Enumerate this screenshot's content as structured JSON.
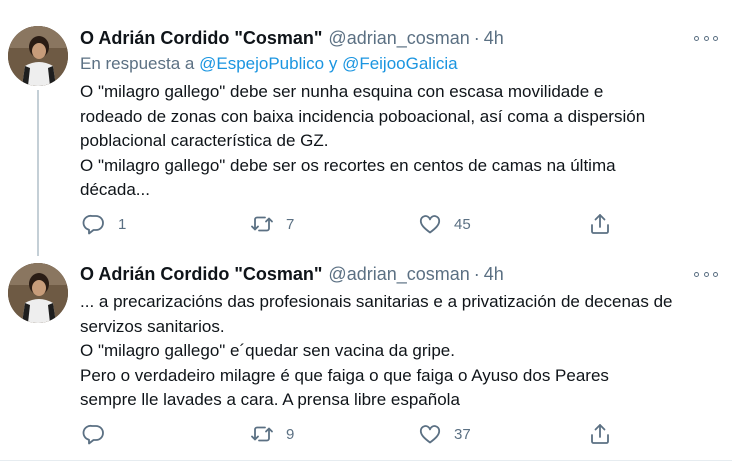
{
  "tweets": [
    {
      "author_name": "O Adrián Cordido \"Cosman\"",
      "handle": "@adrian_cosman",
      "separator": "·",
      "time": "4h",
      "reply_prefix": "En respuesta a",
      "reply_mention_1": "@EspejoPublico",
      "reply_conjunction": "y",
      "reply_mention_2": "@FeijooGalicia",
      "text_lines": [
        "O \"milagro gallego\" debe ser nunha esquina con escasa movilidade e",
        "rodeado de zonas con baixa incidencia poboacional, así coma a dispersión",
        "poblacional característica de GZ.",
        "O \"milagro gallego\" debe ser os recortes en centos de camas na última",
        "década..."
      ],
      "replies": "1",
      "retweets": "7",
      "likes": "45"
    },
    {
      "author_name": "O Adrián Cordido \"Cosman\"",
      "handle": "@adrian_cosman",
      "separator": "·",
      "time": "4h",
      "text_lines": [
        "... a precarizacións das profesionais sanitarias e a privatización de decenas de",
        "servizos sanitarios.",
        "O \"milagro gallego\" e´quedar sen vacina da gripe.",
        "Pero o verdadeiro milagre é que faiga o que faiga o Ayuso dos Peares",
        "sempre lle lavades a cara. A prensa libre española"
      ],
      "replies": "",
      "retweets": "9",
      "likes": "37"
    }
  ],
  "colors": {
    "text": "#0f1419",
    "secondary": "#5b7083",
    "link": "#1b95e0",
    "thread_line": "#c4cfd6"
  },
  "icons": [
    "reply-icon",
    "retweet-icon",
    "like-icon",
    "share-icon",
    "more-icon"
  ]
}
